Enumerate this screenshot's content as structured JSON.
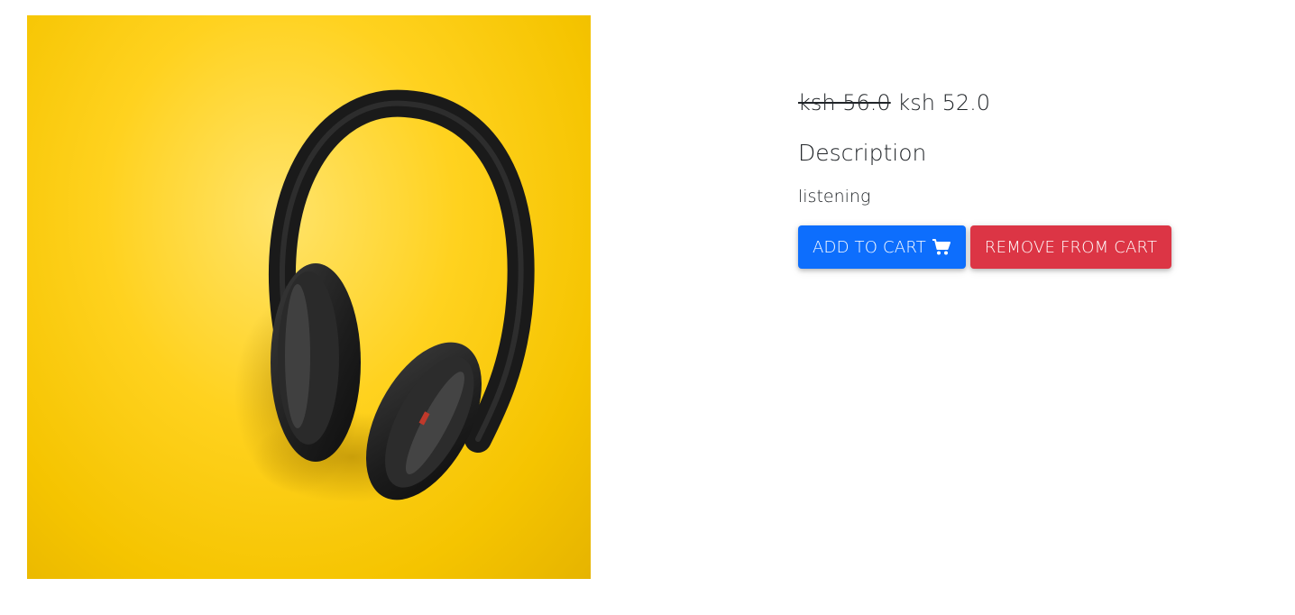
{
  "product": {
    "image_alt": "headphones on yellow background",
    "old_price": "ksh 56.0",
    "price": "ksh 52.0",
    "description_heading": "Description",
    "description_text": "listening"
  },
  "actions": {
    "add_to_cart_label": "ADD TO CART",
    "remove_from_cart_label": "REMOVE FROM CART"
  },
  "icons": {
    "cart": "shopping-cart-icon"
  },
  "colors": {
    "add_button": "#0d6efd",
    "remove_button": "#dc3545",
    "image_background": "#ffd21f"
  }
}
